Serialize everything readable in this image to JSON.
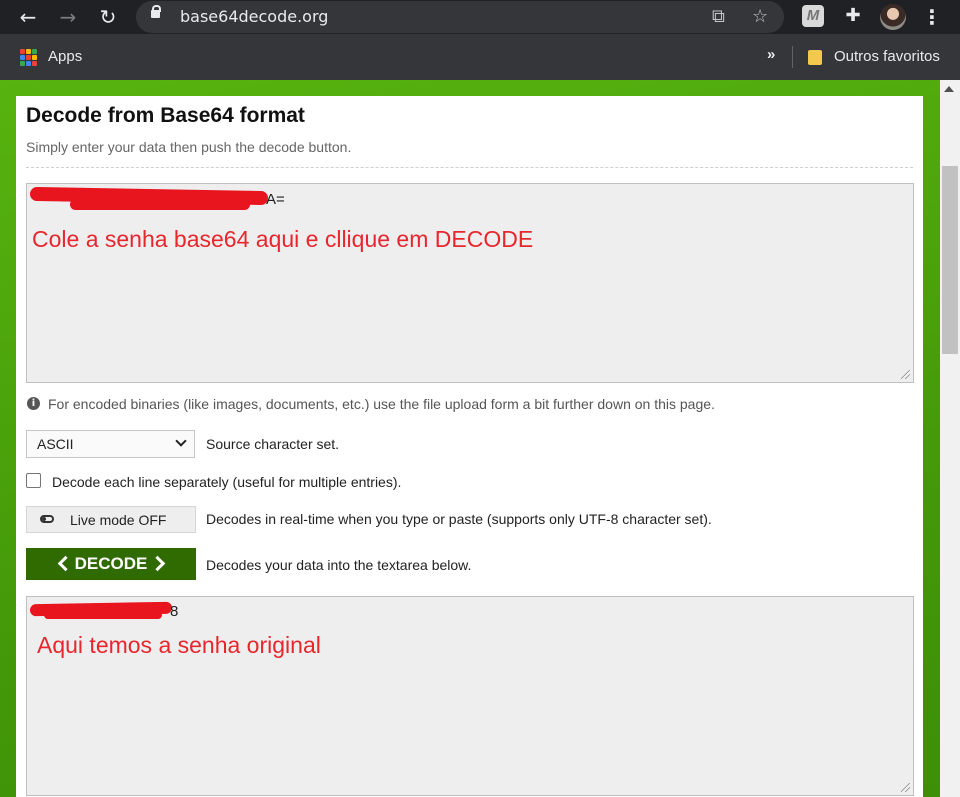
{
  "browser": {
    "url": "base64decode.org",
    "bookmarks": {
      "apps_label": "Apps",
      "overflow": "»",
      "folder_label": "Outros favoritos"
    },
    "icons": [
      "back-icon",
      "forward-icon",
      "reload-icon",
      "lock-icon",
      "translate-icon",
      "star-icon",
      "extension-m-icon",
      "puzzle-icon",
      "avatar",
      "menu-icon"
    ]
  },
  "page": {
    "title": "Decode from Base64 format",
    "subtitle": "Simply enter your data then push the decode button.",
    "input": {
      "visible_tail": "A=",
      "annotation": "Cole a senha base64 aqui e cllique em DECODE"
    },
    "info_note": "For encoded binaries (like images, documents, etc.) use the file upload form a bit further down on this page.",
    "charset": {
      "selected": "ASCII",
      "label": "Source character set."
    },
    "line_option": {
      "label": "Decode each line separately (useful for multiple entries).",
      "checked": false
    },
    "live_mode": {
      "button": "Live mode OFF",
      "label": "Decodes in real-time when you type or paste (supports only UTF-8 character set)."
    },
    "decode": {
      "button": "DECODE",
      "label": "Decodes your data into the textarea below."
    },
    "output": {
      "visible_tail": "8",
      "annotation": "Aqui temos a senha original"
    }
  },
  "colors": {
    "accent_green": "#2f6b00",
    "annotation_red": "#e8262e",
    "page_bg_green": "#4a9a0e"
  }
}
